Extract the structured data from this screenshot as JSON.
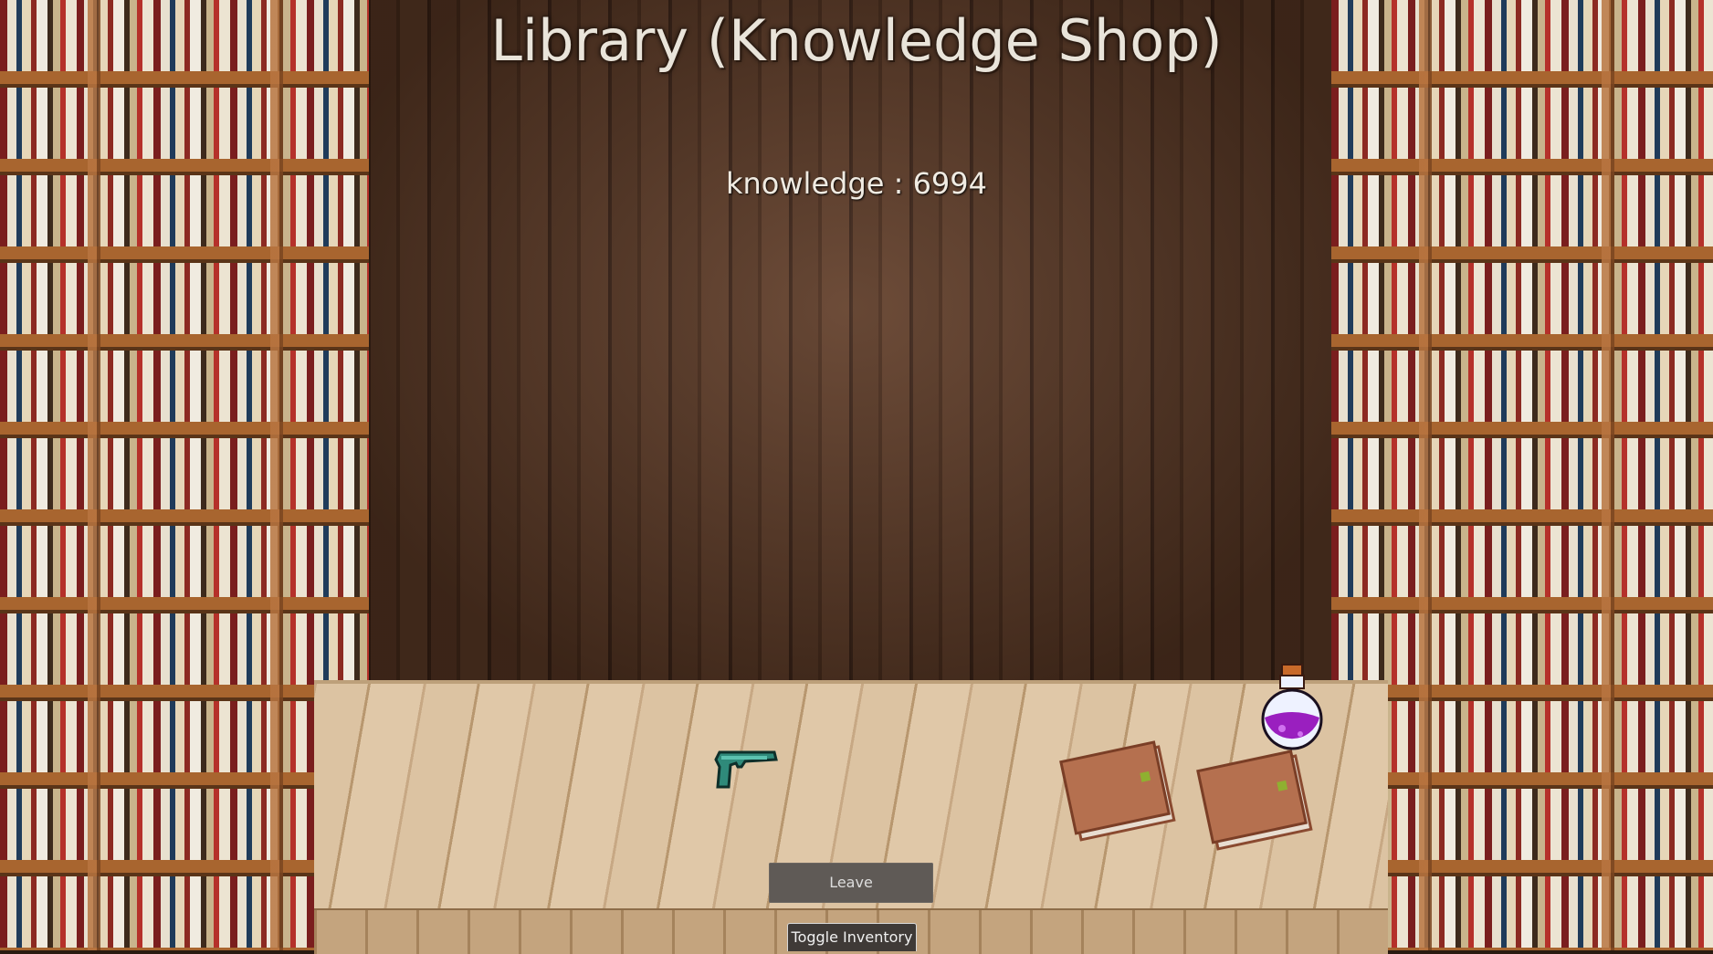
{
  "scene": {
    "title": "Library (Knowledge Shop)",
    "knowledge_label": "knowledge : 6994",
    "knowledge_value": 6994
  },
  "shop_items": [
    {
      "name": "pistol",
      "icon": "pistol-icon"
    },
    {
      "name": "book",
      "icon": "book-icon"
    },
    {
      "name": "book",
      "icon": "book-icon"
    },
    {
      "name": "potion",
      "icon": "potion-icon"
    }
  ],
  "buttons": {
    "leave": "Leave",
    "toggle_inventory": "Toggle Inventory"
  },
  "colors": {
    "wall": "#4a2c1b",
    "counter": "#d8bf9c",
    "button": "#5f5a56",
    "potion": "#a020c0",
    "book": "#b5704f",
    "pistol": "#2f8a7a"
  }
}
